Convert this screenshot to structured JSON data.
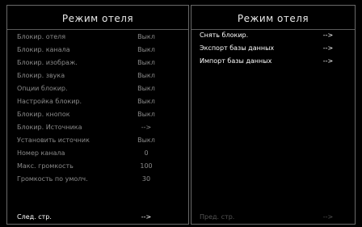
{
  "left_panel": {
    "title": "Режим отеля",
    "items": [
      {
        "label": "Блокир. отеля",
        "value": "Выкл"
      },
      {
        "label": "Блокир. канала",
        "value": "Выкл"
      },
      {
        "label": "Блокир. изображ.",
        "value": "Выкл"
      },
      {
        "label": "Блокир. звука",
        "value": "Выкл"
      },
      {
        "label": "Опции блокир.",
        "value": "Выкл"
      },
      {
        "label": "Настройка блокир.",
        "value": "Выкл"
      },
      {
        "label": "Блокир. кнопок",
        "value": "Выкл"
      },
      {
        "label": "Блокир. Источника",
        "value": "-->"
      },
      {
        "label": "Установить источник",
        "value": "Выкл"
      },
      {
        "label": "Номер канала",
        "value": "0"
      },
      {
        "label": "Макс. громкость",
        "value": "100"
      },
      {
        "label": "Громкость по умолч.",
        "value": "30"
      }
    ],
    "footer": {
      "label": "След. стр.",
      "value": "-->"
    }
  },
  "right_panel": {
    "title": "Режим отеля",
    "items": [
      {
        "label": "Снять блокир.",
        "value": "-->"
      },
      {
        "label": "Экспорт базы данных",
        "value": "-->"
      },
      {
        "label": "Импорт базы данных",
        "value": "-->"
      }
    ],
    "footer": {
      "label": "Пред. стр.",
      "value": "-->"
    }
  }
}
